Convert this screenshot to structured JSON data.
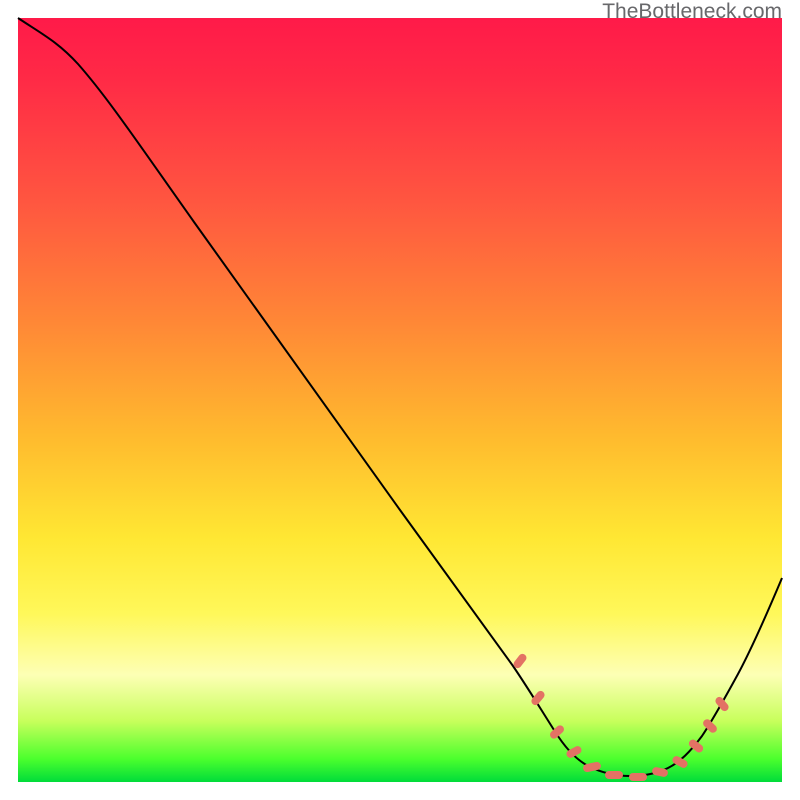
{
  "watermark": "TheBottleneck.com",
  "colors": {
    "gradient_top": "#ff1a49",
    "gradient_mid1": "#ff8836",
    "gradient_mid2": "#ffe733",
    "gradient_bottom": "#00dc3a",
    "curve_stroke": "#000000",
    "marker_fill": "#e37264"
  },
  "chart_data": {
    "type": "line",
    "title": "",
    "xlabel": "",
    "ylabel": "",
    "xlim": [
      0,
      100
    ],
    "ylim": [
      0,
      100
    ],
    "grid": false,
    "series": [
      {
        "name": "bottleneck-curve",
        "x": [
          0,
          3,
          6,
          10,
          15,
          20,
          25,
          30,
          35,
          40,
          45,
          50,
          55,
          60,
          64,
          66,
          68,
          69,
          70,
          72,
          74,
          76,
          78,
          80,
          82,
          84,
          86,
          88,
          90,
          92,
          94,
          96,
          98,
          100
        ],
        "values": [
          100,
          98,
          96,
          93,
          89,
          84,
          78,
          71,
          64,
          57,
          50,
          43,
          36,
          28,
          20,
          15,
          11,
          8,
          6,
          4,
          3,
          2,
          1,
          1,
          1,
          1,
          2,
          4,
          6,
          9,
          13,
          18,
          23,
          29
        ]
      }
    ],
    "markers": {
      "name": "dotted-trough",
      "x": [
        66,
        68.5,
        71,
        73,
        75,
        77.5,
        80,
        82.5,
        85,
        87,
        89,
        90.5
      ],
      "values": [
        15,
        10,
        6,
        4,
        3,
        2,
        1,
        1,
        2,
        4,
        7,
        10
      ]
    }
  }
}
